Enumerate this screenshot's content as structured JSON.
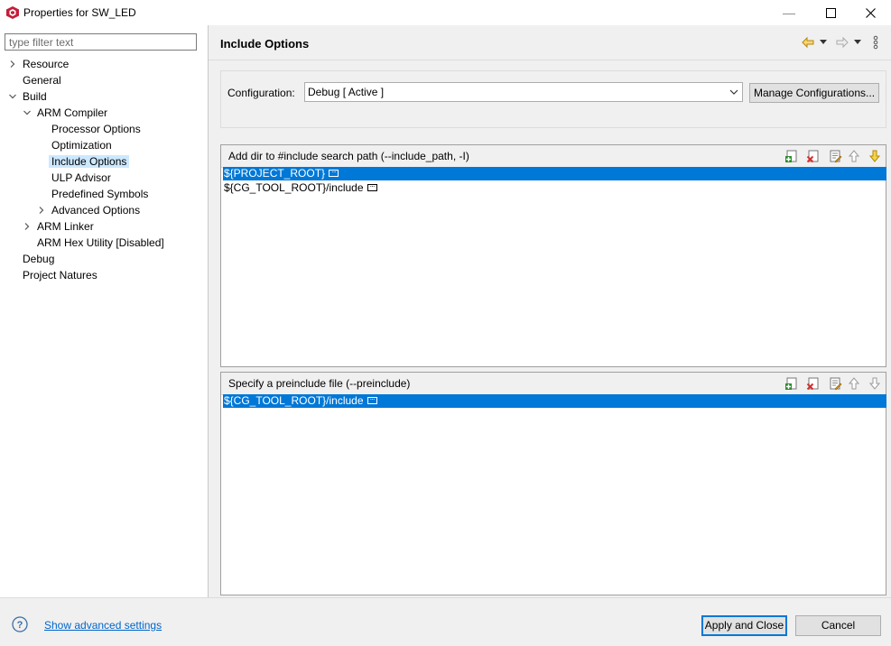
{
  "window": {
    "title": "Properties for SW_LED",
    "minimize_glyph": "—",
    "maximize_glyph": "☐",
    "close_glyph": "✕"
  },
  "filter": {
    "placeholder": "type filter text",
    "value": ""
  },
  "tree": [
    {
      "label": "Resource",
      "level": 0,
      "expander": "collapsed"
    },
    {
      "label": "General",
      "level": 0,
      "expander": "none"
    },
    {
      "label": "Build",
      "level": 0,
      "expander": "expanded"
    },
    {
      "label": "ARM Compiler",
      "level": 1,
      "expander": "expanded"
    },
    {
      "label": "Processor Options",
      "level": 2,
      "expander": "none"
    },
    {
      "label": "Optimization",
      "level": 2,
      "expander": "none"
    },
    {
      "label": "Include Options",
      "level": 2,
      "expander": "none",
      "selected": true
    },
    {
      "label": "ULP Advisor",
      "level": 2,
      "expander": "none"
    },
    {
      "label": "Predefined Symbols",
      "level": 2,
      "expander": "none"
    },
    {
      "label": "Advanced Options",
      "level": 2,
      "expander": "collapsed"
    },
    {
      "label": "ARM Linker",
      "level": 1,
      "expander": "collapsed"
    },
    {
      "label": "ARM Hex Utility  [Disabled]",
      "level": 1,
      "expander": "none"
    },
    {
      "label": "Debug",
      "level": 0,
      "expander": "none"
    },
    {
      "label": "Project Natures",
      "level": 0,
      "expander": "none"
    }
  ],
  "page": {
    "title": "Include Options"
  },
  "configuration": {
    "label": "Configuration:",
    "selected": "Debug  [ Active ]",
    "manage_label": "Manage Configurations..."
  },
  "include_paths": {
    "title": "Add dir to #include search path (--include_path, -I)",
    "items": [
      {
        "value": "${PROJECT_ROOT}",
        "selected": true
      },
      {
        "value": "${CG_TOOL_ROOT}/include",
        "selected": false
      }
    ]
  },
  "preinclude": {
    "title": "Specify a preinclude file (--preinclude)",
    "items": [
      {
        "value": "${CG_TOOL_ROOT}/include",
        "selected": true
      }
    ]
  },
  "toolbar_icons": [
    "add-icon",
    "delete-icon",
    "edit-icon",
    "move-up-icon",
    "move-down-icon"
  ],
  "footer": {
    "advanced_link": "Show advanced settings",
    "apply_label": "Apply and Close",
    "cancel_label": "Cancel"
  },
  "colors": {
    "selection": "#0078d7",
    "tree_selection": "#cce8ff",
    "link": "#0066cc",
    "brand_red": "#c41e3a"
  }
}
